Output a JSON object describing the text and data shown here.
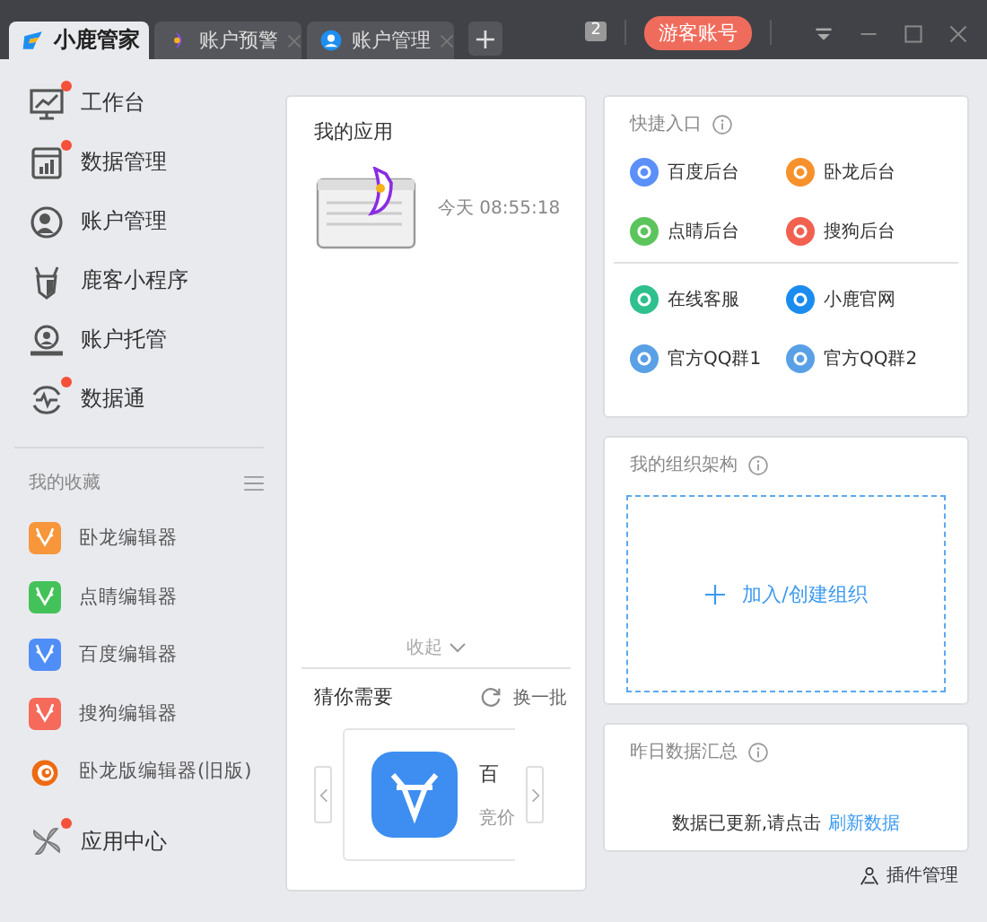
{
  "tabs": [
    {
      "label": "小鹿管家",
      "selected": true,
      "closable": false
    },
    {
      "label": "账户预警",
      "selected": false,
      "closable": true
    },
    {
      "label": "账户管理",
      "selected": false,
      "closable": true
    }
  ],
  "new_tab": "+",
  "window_count": "2",
  "guest_button": "游客账号",
  "nav": [
    {
      "label": "工作台",
      "badge": true
    },
    {
      "label": "数据管理",
      "badge": true
    },
    {
      "label": "账户管理",
      "badge": false
    },
    {
      "label": "鹿客小程序",
      "badge": false
    },
    {
      "label": "账户托管",
      "badge": false
    },
    {
      "label": "数据通",
      "badge": true
    }
  ],
  "favorites": {
    "title": "我的收藏",
    "items": [
      {
        "label": "卧龙编辑器",
        "kind": "tile",
        "color": "#f7963a"
      },
      {
        "label": "点睛编辑器",
        "kind": "tile",
        "color": "#44c25a"
      },
      {
        "label": "百度编辑器",
        "kind": "tile",
        "color": "#4f8ef7"
      },
      {
        "label": "搜狗编辑器",
        "kind": "tile",
        "color": "#f56a5a"
      },
      {
        "label": "卧龙版编辑器(旧版)",
        "kind": "spiral",
        "color": "#ee6a12"
      }
    ]
  },
  "app_center": {
    "label": "应用中心",
    "badge": true
  },
  "my_apps": {
    "title": "我的应用",
    "items": [
      {
        "time": "今天 08:55:18"
      }
    ],
    "collapse": "收起"
  },
  "suggest": {
    "title": "猜你需要",
    "refresh": "换一批",
    "cards": [
      {
        "name": "百",
        "desc": "竞价"
      }
    ]
  },
  "quick": {
    "title": "快捷入口",
    "groups": [
      [
        {
          "label": "百度后台",
          "color": "#5b8ff9"
        },
        {
          "label": "卧龙后台",
          "color": "#f7912c"
        },
        {
          "label": "点睛后台",
          "color": "#5cc45c"
        },
        {
          "label": "搜狗后台",
          "color": "#f2604f"
        }
      ],
      [
        {
          "label": "在线客服",
          "color": "#2ec08d"
        },
        {
          "label": "小鹿官网",
          "color": "#1a8cf0"
        },
        {
          "label": "官方QQ群1",
          "color": "#5aa0e6"
        },
        {
          "label": "官方QQ群2",
          "color": "#5aa0e6"
        }
      ]
    ]
  },
  "org": {
    "title": "我的组织架构",
    "add": "加入/创建组织"
  },
  "yesterday": {
    "title": "昨日数据汇总",
    "notice": "数据已更新,请点击",
    "refresh_link": "刷新数据"
  },
  "plugin_link": "插件管理"
}
